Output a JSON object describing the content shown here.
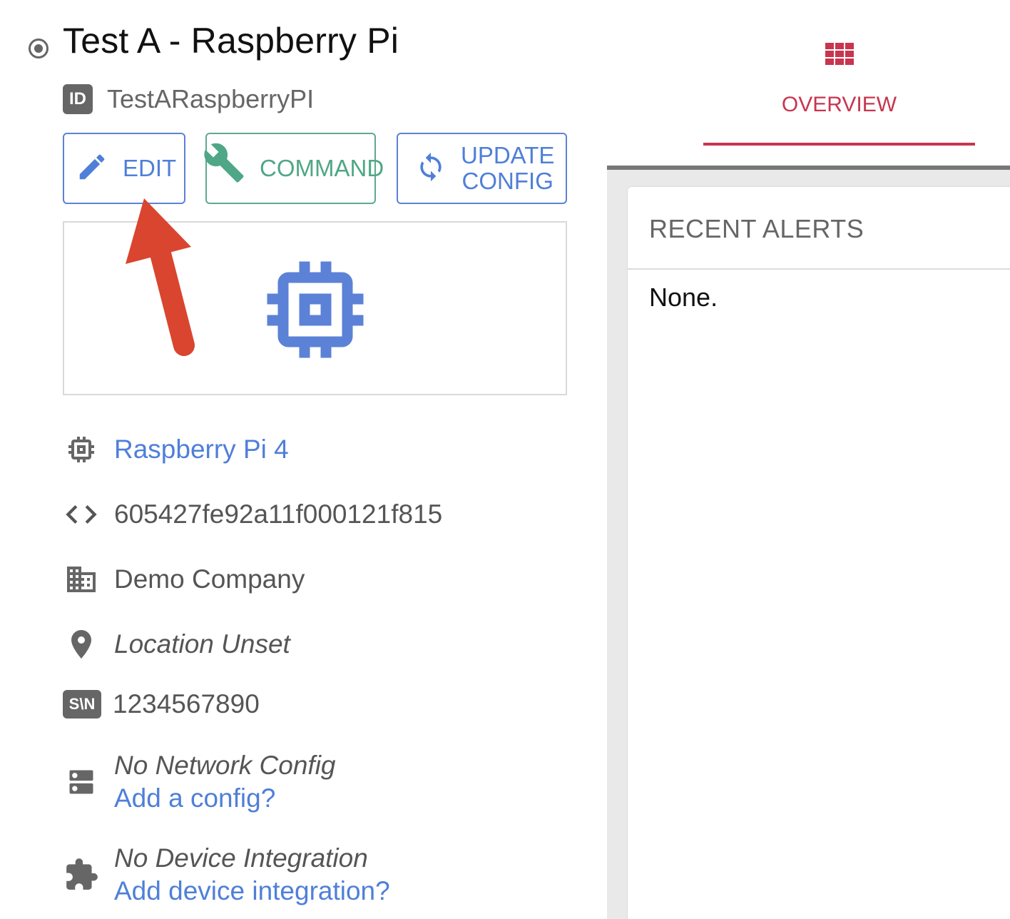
{
  "device": {
    "title": "Test A - Raspberry Pi",
    "id_badge": "ID",
    "id_value": "TestARaspberryPI"
  },
  "actions": {
    "edit_label": "EDIT",
    "command_label": "COMMAND",
    "update_label_line1": "UPDATE",
    "update_label_line2": "CONFIG"
  },
  "details": {
    "model": "Raspberry Pi 4",
    "hash": "605427fe92a11f000121f815",
    "company": "Demo Company",
    "location": "Location Unset",
    "serial_badge": "S\\N",
    "serial": "1234567890",
    "network_status": "No Network Config",
    "network_link": "Add a config?",
    "integration_status": "No Device Integration",
    "integration_link": "Add device integration?"
  },
  "tabs": [
    {
      "label": "OVERVIEW",
      "icon": "grid-icon",
      "active": true
    }
  ],
  "alerts": {
    "title": "RECENT ALERTS",
    "empty_text": "None."
  },
  "colors": {
    "primary_blue": "#4f7fd8",
    "command_green": "#4fa787",
    "accent_red": "#c8354f",
    "annotation_arrow": "#d9452f"
  }
}
